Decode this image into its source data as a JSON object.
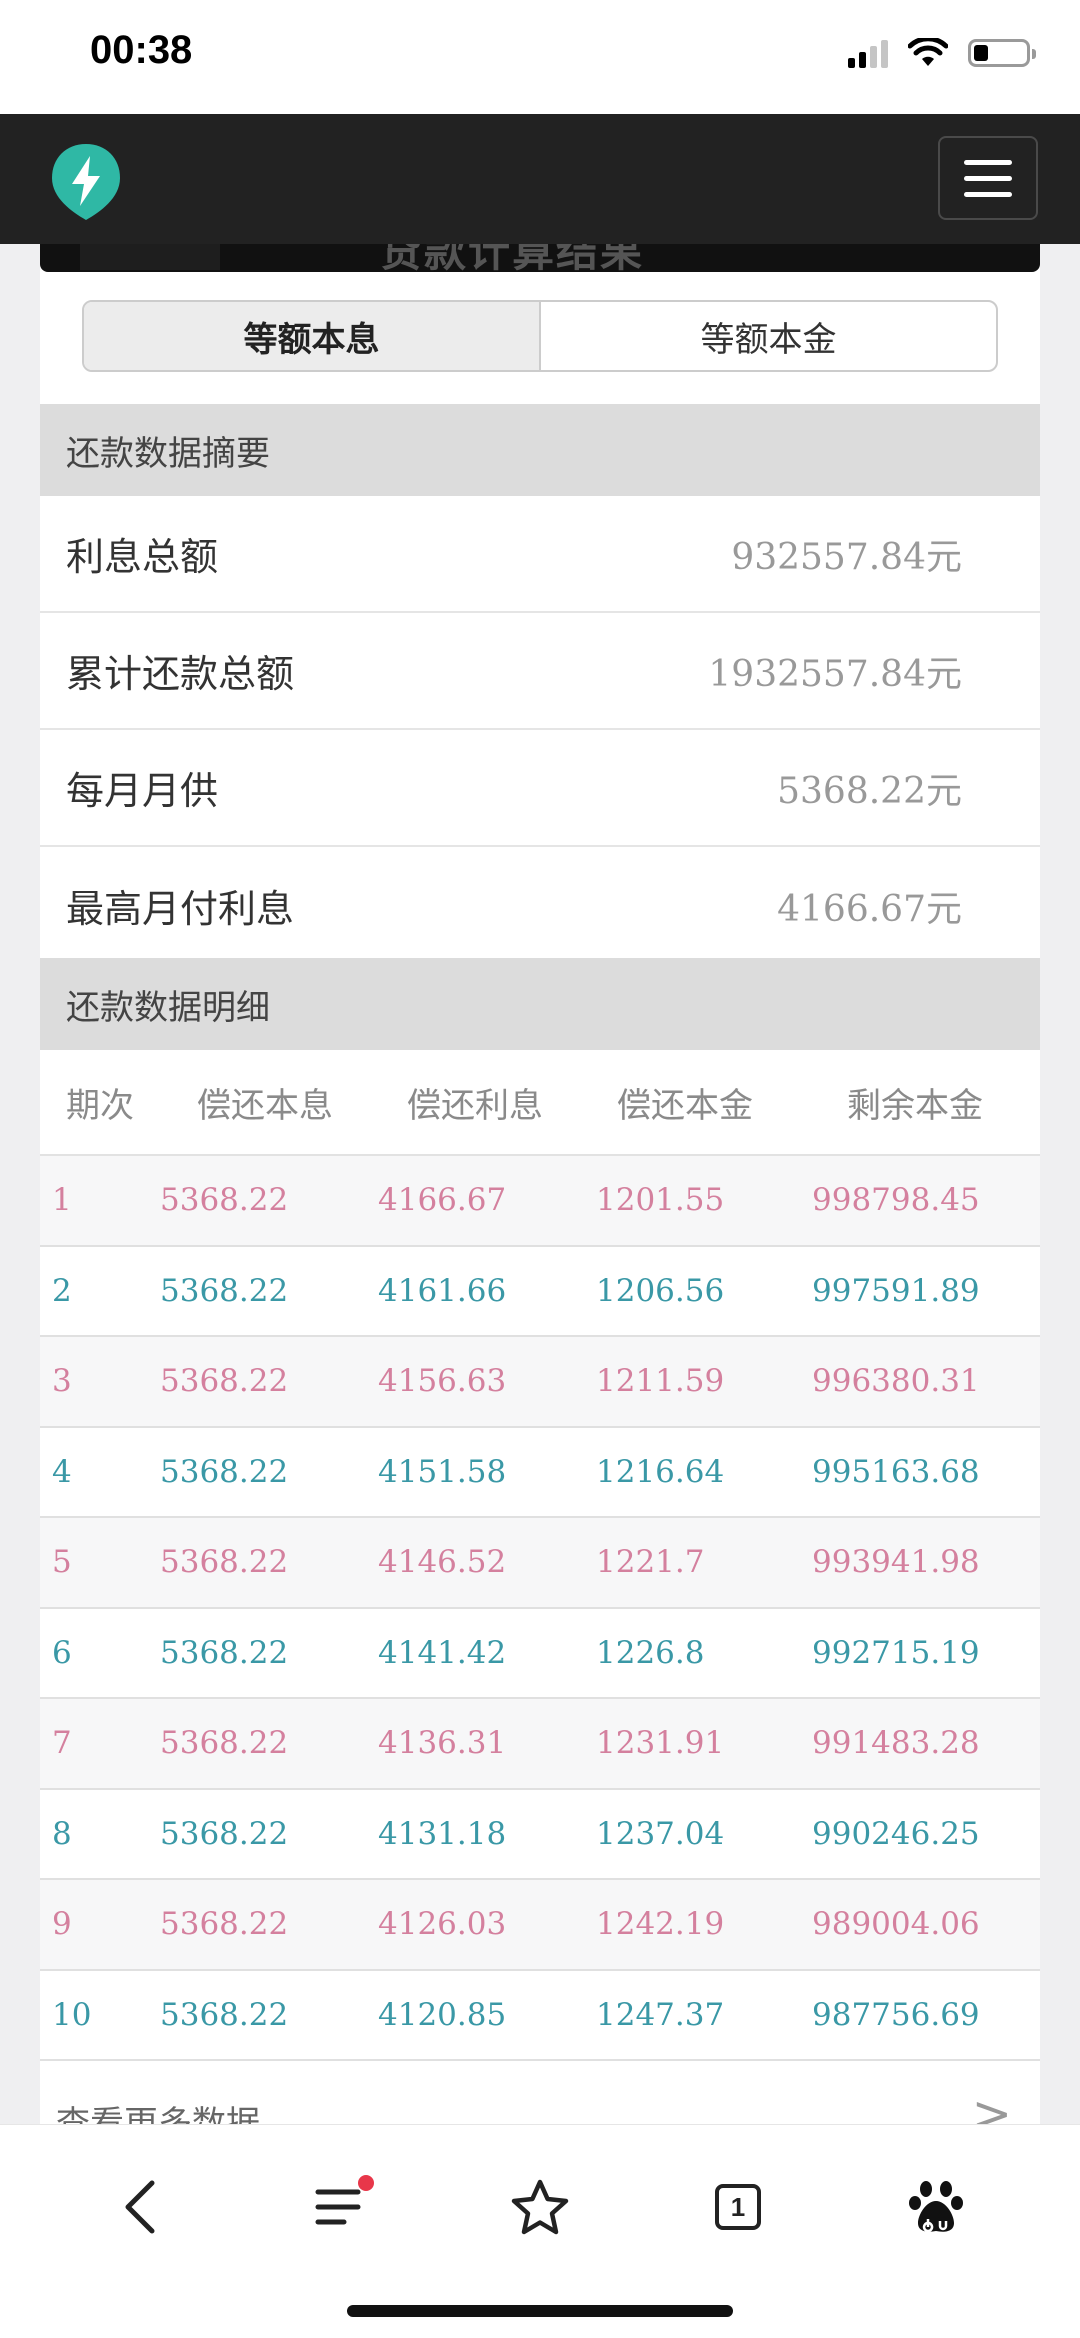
{
  "status_bar": {
    "time": "00:38"
  },
  "segmented": {
    "tabs": [
      "等额本息",
      "等额本金"
    ]
  },
  "hidden_title": "贷款计算结果",
  "summary": {
    "header": "还款数据摘要",
    "rows": [
      {
        "label": "利息总额",
        "value": "932557.84元"
      },
      {
        "label": "累计还款总额",
        "value": "1932557.84元"
      },
      {
        "label": "每月月供",
        "value": "5368.22元"
      },
      {
        "label": "最高月付利息",
        "value": "4166.67元"
      }
    ]
  },
  "detail": {
    "header": "还款数据明细",
    "columns": [
      "期次",
      "偿还本息",
      "偿还利息",
      "偿还本金",
      "剩余本金"
    ],
    "rows": [
      [
        "1",
        "5368.22",
        "4166.67",
        "1201.55",
        "998798.45"
      ],
      [
        "2",
        "5368.22",
        "4161.66",
        "1206.56",
        "997591.89"
      ],
      [
        "3",
        "5368.22",
        "4156.63",
        "1211.59",
        "996380.31"
      ],
      [
        "4",
        "5368.22",
        "4151.58",
        "1216.64",
        "995163.68"
      ],
      [
        "5",
        "5368.22",
        "4146.52",
        "1221.7",
        "993941.98"
      ],
      [
        "6",
        "5368.22",
        "4141.42",
        "1226.8",
        "992715.19"
      ],
      [
        "7",
        "5368.22",
        "4136.31",
        "1231.91",
        "991483.28"
      ],
      [
        "8",
        "5368.22",
        "4131.18",
        "1237.04",
        "990246.25"
      ],
      [
        "9",
        "5368.22",
        "4126.03",
        "1242.19",
        "989004.06"
      ],
      [
        "10",
        "5368.22",
        "4120.85",
        "1247.37",
        "987756.69"
      ]
    ],
    "more_label": "查看更多数据",
    "more_chevron": ">"
  },
  "toolbar": {
    "tab_count": "1",
    "icons": [
      "back-icon",
      "menu-list-icon",
      "star-icon",
      "tabs-icon",
      "baidu-paw-icon"
    ]
  },
  "colors": {
    "odd_row": "#d4809e",
    "even_row": "#3a98a6",
    "nav_bg": "#222222",
    "logo": "#2fb8a5"
  }
}
